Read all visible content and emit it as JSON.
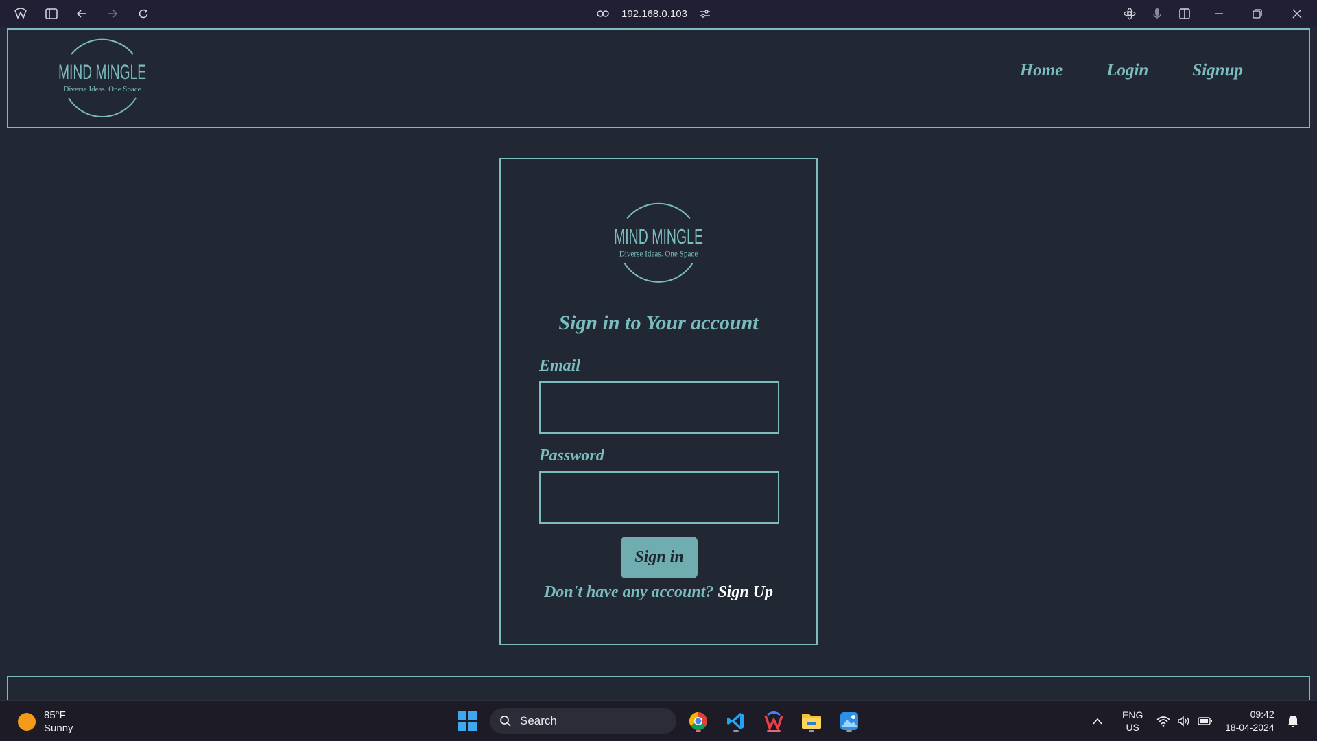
{
  "browser": {
    "address": "192.168.0.103"
  },
  "brand": {
    "name": "MIND MINGLE",
    "tagline": "Diverse Ideas. One Space"
  },
  "nav": {
    "home": "Home",
    "login": "Login",
    "signup": "Signup"
  },
  "login": {
    "title": "Sign in to Your account",
    "email_label": "Email",
    "email_value": "",
    "password_label": "Password",
    "password_value": "",
    "submit": "Sign in",
    "prompt": "Don't have any account?",
    "signup_link": "Sign Up"
  },
  "taskbar": {
    "temperature": "85°F",
    "condition": "Sunny",
    "search_label": "Search",
    "lang_top": "ENG",
    "lang_bottom": "US",
    "time": "09:42",
    "date": "18-04-2024"
  },
  "colors": {
    "accent": "#7bbcbf",
    "background": "#222833",
    "button": "#6fadb0",
    "link": "#ffffff"
  }
}
